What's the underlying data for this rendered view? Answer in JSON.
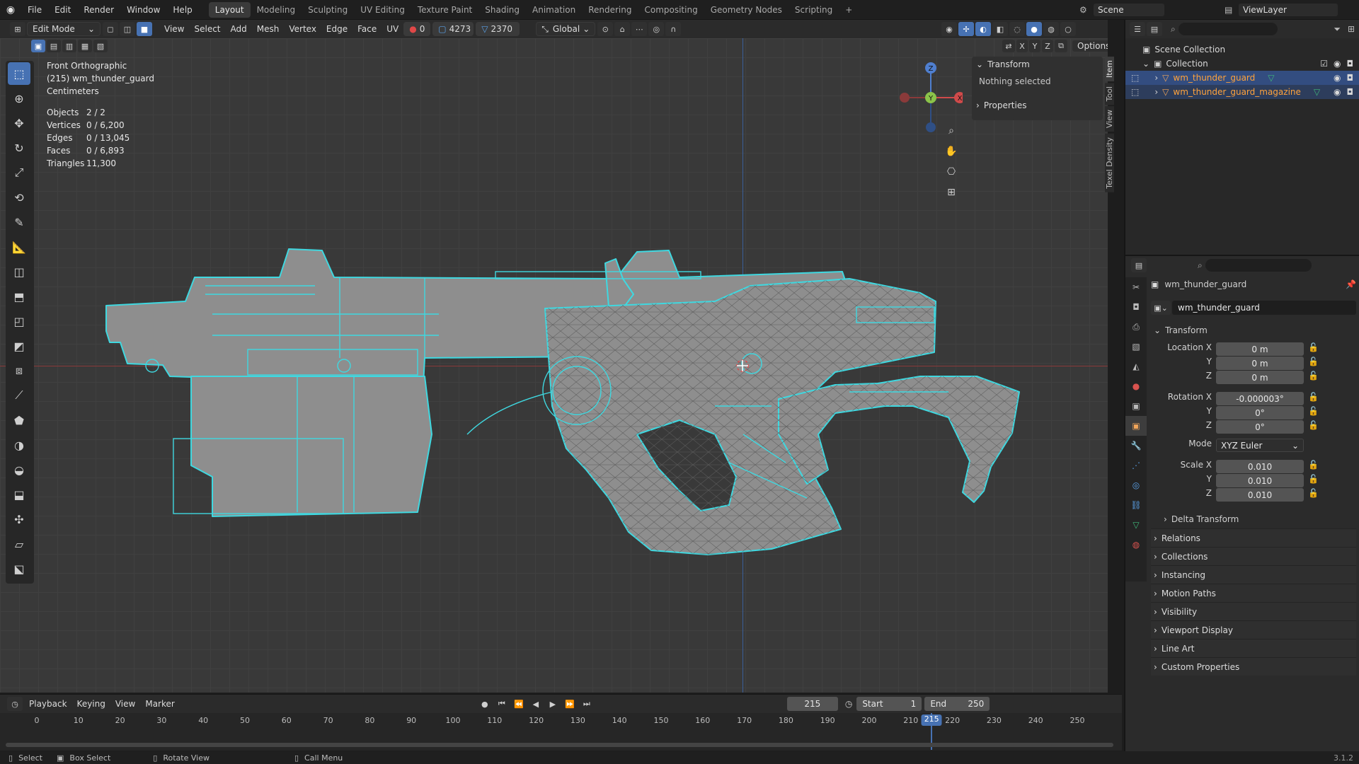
{
  "menubar": {
    "items": [
      "File",
      "Edit",
      "Render",
      "Window",
      "Help"
    ],
    "workspaces": [
      "Layout",
      "Modeling",
      "Sculpting",
      "UV Editing",
      "Texture Paint",
      "Shading",
      "Animation",
      "Rendering",
      "Compositing",
      "Geometry Nodes",
      "Scripting"
    ],
    "active_workspace": "Layout",
    "add_tab": "+",
    "scene_label": "Scene",
    "viewlayer_label": "ViewLayer"
  },
  "viewport_header": {
    "mode": "Edit Mode",
    "menus": [
      "View",
      "Select",
      "Add",
      "Mesh",
      "Vertex",
      "Edge",
      "Face",
      "UV"
    ],
    "counter_a": "0",
    "counter_b": "4273",
    "counter_c": "2370",
    "orientation": "Global",
    "options": "Options",
    "axes": [
      "X",
      "Y",
      "Z"
    ]
  },
  "overlay": {
    "view_name": "Front Orthographic",
    "object_line": "(215) wm_thunder_guard",
    "units": "Centimeters",
    "stats": [
      {
        "label": "Objects",
        "value": "2 / 2"
      },
      {
        "label": "Vertices",
        "value": "0 / 6,200"
      },
      {
        "label": "Edges",
        "value": "0 / 13,045"
      },
      {
        "label": "Faces",
        "value": "0 / 6,893"
      },
      {
        "label": "Triangles",
        "value": "11,300"
      }
    ]
  },
  "gizmo": {
    "x": "X",
    "y": "Y",
    "z": "Z"
  },
  "npanel": {
    "transform_header": "Transform",
    "nothing_selected": "Nothing selected",
    "properties_header": "Properties",
    "tabs": [
      "Item",
      "Tool",
      "View",
      "Texel Density"
    ]
  },
  "outliner": {
    "scene_collection": "Scene Collection",
    "collection": "Collection",
    "objects": [
      "wm_thunder_guard",
      "wm_thunder_guard_magazine"
    ]
  },
  "properties": {
    "object_name": "wm_thunder_guard",
    "data_name": "wm_thunder_guard",
    "transform_header": "Transform",
    "location_label": "Location X",
    "location": [
      "0 m",
      "0 m",
      "0 m"
    ],
    "rotation_label": "Rotation X",
    "rotation": [
      "-0.000003°",
      "0°",
      "0°"
    ],
    "mode_label": "Mode",
    "mode_value": "XYZ Euler",
    "scale_label": "Scale X",
    "scale": [
      "0.010",
      "0.010",
      "0.010"
    ],
    "axis_y": "Y",
    "axis_z": "Z",
    "sections": [
      "Delta Transform",
      "Relations",
      "Collections",
      "Instancing",
      "Motion Paths",
      "Visibility",
      "Viewport Display",
      "Line Art",
      "Custom Properties"
    ]
  },
  "timeline": {
    "menus": [
      "Playback",
      "Keying",
      "View",
      "Marker"
    ],
    "current_frame": "215",
    "start_label": "Start",
    "start": "1",
    "end_label": "End",
    "end": "250",
    "ticks": [
      "0",
      "10",
      "20",
      "30",
      "40",
      "50",
      "60",
      "70",
      "80",
      "90",
      "100",
      "110",
      "120",
      "130",
      "140",
      "150",
      "160",
      "170",
      "180",
      "190",
      "200",
      "210",
      "220",
      "230",
      "240",
      "250"
    ],
    "playhead": "215"
  },
  "statusbar": {
    "select": "Select",
    "box_select": "Box Select",
    "rotate_view": "Rotate View",
    "call_menu": "Call Menu",
    "version": "3.1.2"
  },
  "colors": {
    "accent": "#4772b3",
    "wire": "#3fd8e0",
    "mesh": "#8e8e8e",
    "selected_text": "#ffa33c"
  }
}
